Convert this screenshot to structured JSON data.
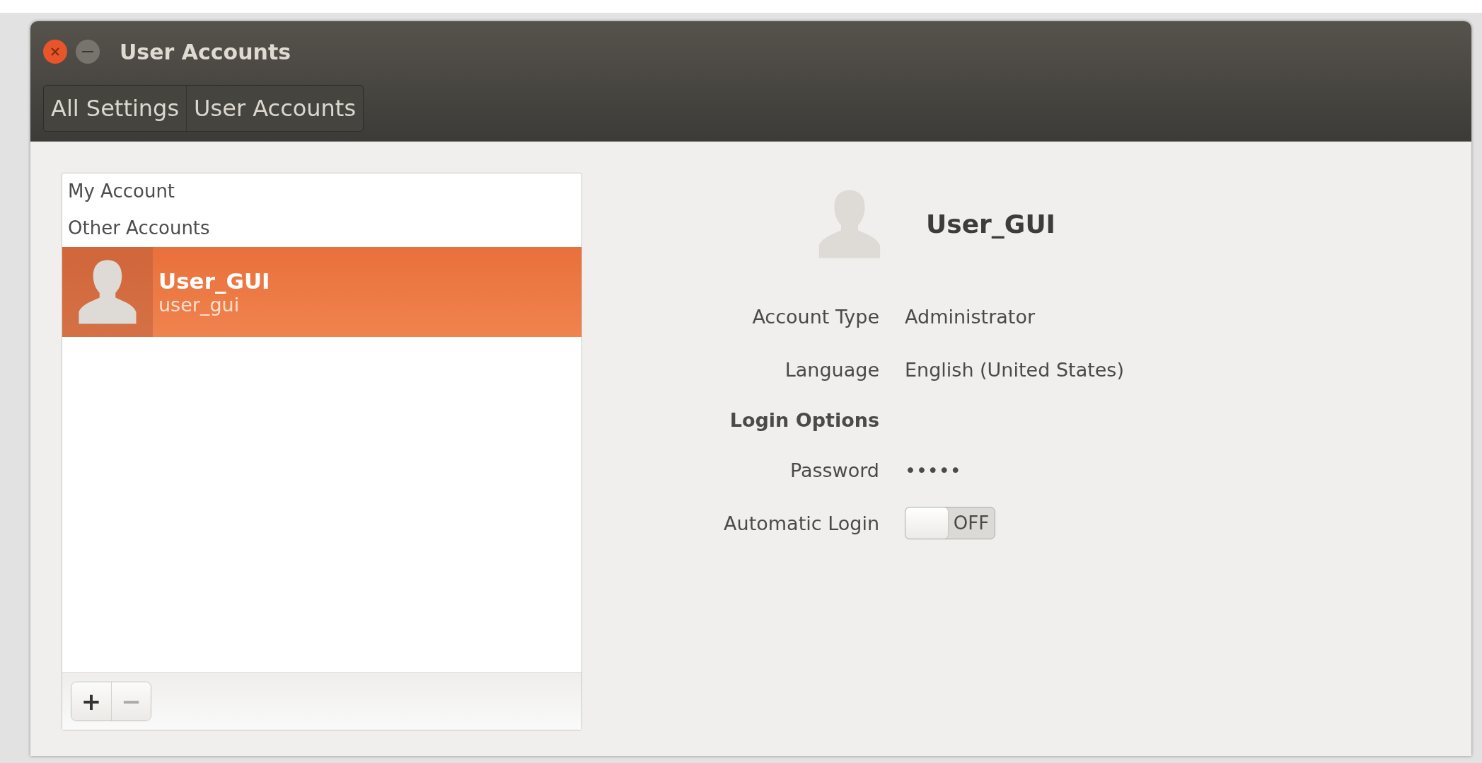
{
  "window": {
    "title": "User Accounts"
  },
  "breadcrumbs": [
    "All Settings",
    "User Accounts"
  ],
  "account_list": {
    "sections": [
      {
        "label": "My Account"
      },
      {
        "label": "Other Accounts",
        "accounts": [
          {
            "name": "User_GUI",
            "login": "user_gui",
            "selected": true
          }
        ]
      }
    ],
    "buttons": [
      "+",
      "−"
    ]
  },
  "details": {
    "name": "User_GUI",
    "fields": [
      {
        "kind": "text",
        "label": "Account Type",
        "value": "Administrator"
      },
      {
        "kind": "text",
        "label": "Language",
        "value": "English (United States)"
      },
      {
        "kind": "heading",
        "label": "Login Options"
      },
      {
        "kind": "text",
        "label": "Password",
        "value": "•••••"
      },
      {
        "kind": "switch",
        "label": "Automatic Login",
        "on": false,
        "state_label": "OFF"
      }
    ]
  }
}
